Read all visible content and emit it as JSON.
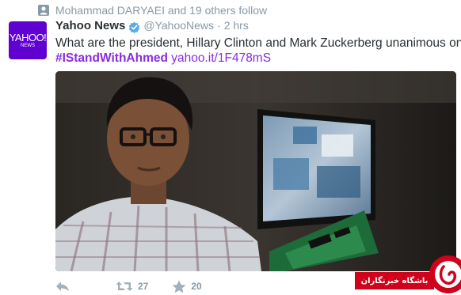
{
  "context": {
    "text": "Mohammad DARYAEI and 19 others follow",
    "icon": "person-icon"
  },
  "avatar": {
    "logo_main": "YAHOO!",
    "logo_sub": "NEWS",
    "bg_color": "#5f01d1"
  },
  "tweet": {
    "name": "Yahoo News",
    "handle": "@YahooNews",
    "separator": "·",
    "time": "2 hrs",
    "text": "What are the president, Hillary Clinton and Mark Zuckerberg unanimous on?",
    "hashtag": "#IStandWithAhmed",
    "link": "yahoo.it/1F478mS"
  },
  "actions": {
    "reply_icon": "reply-icon",
    "retweet_icon": "retweet-icon",
    "retweet_count": "27",
    "favorite_icon": "star-icon",
    "favorite_count": "20"
  },
  "watermark": {
    "text": "باشگاه خبرنگاران",
    "color": "#d0021b"
  },
  "colors": {
    "accent": "#8a2be2",
    "muted": "#8899a6",
    "text": "#292f33"
  }
}
